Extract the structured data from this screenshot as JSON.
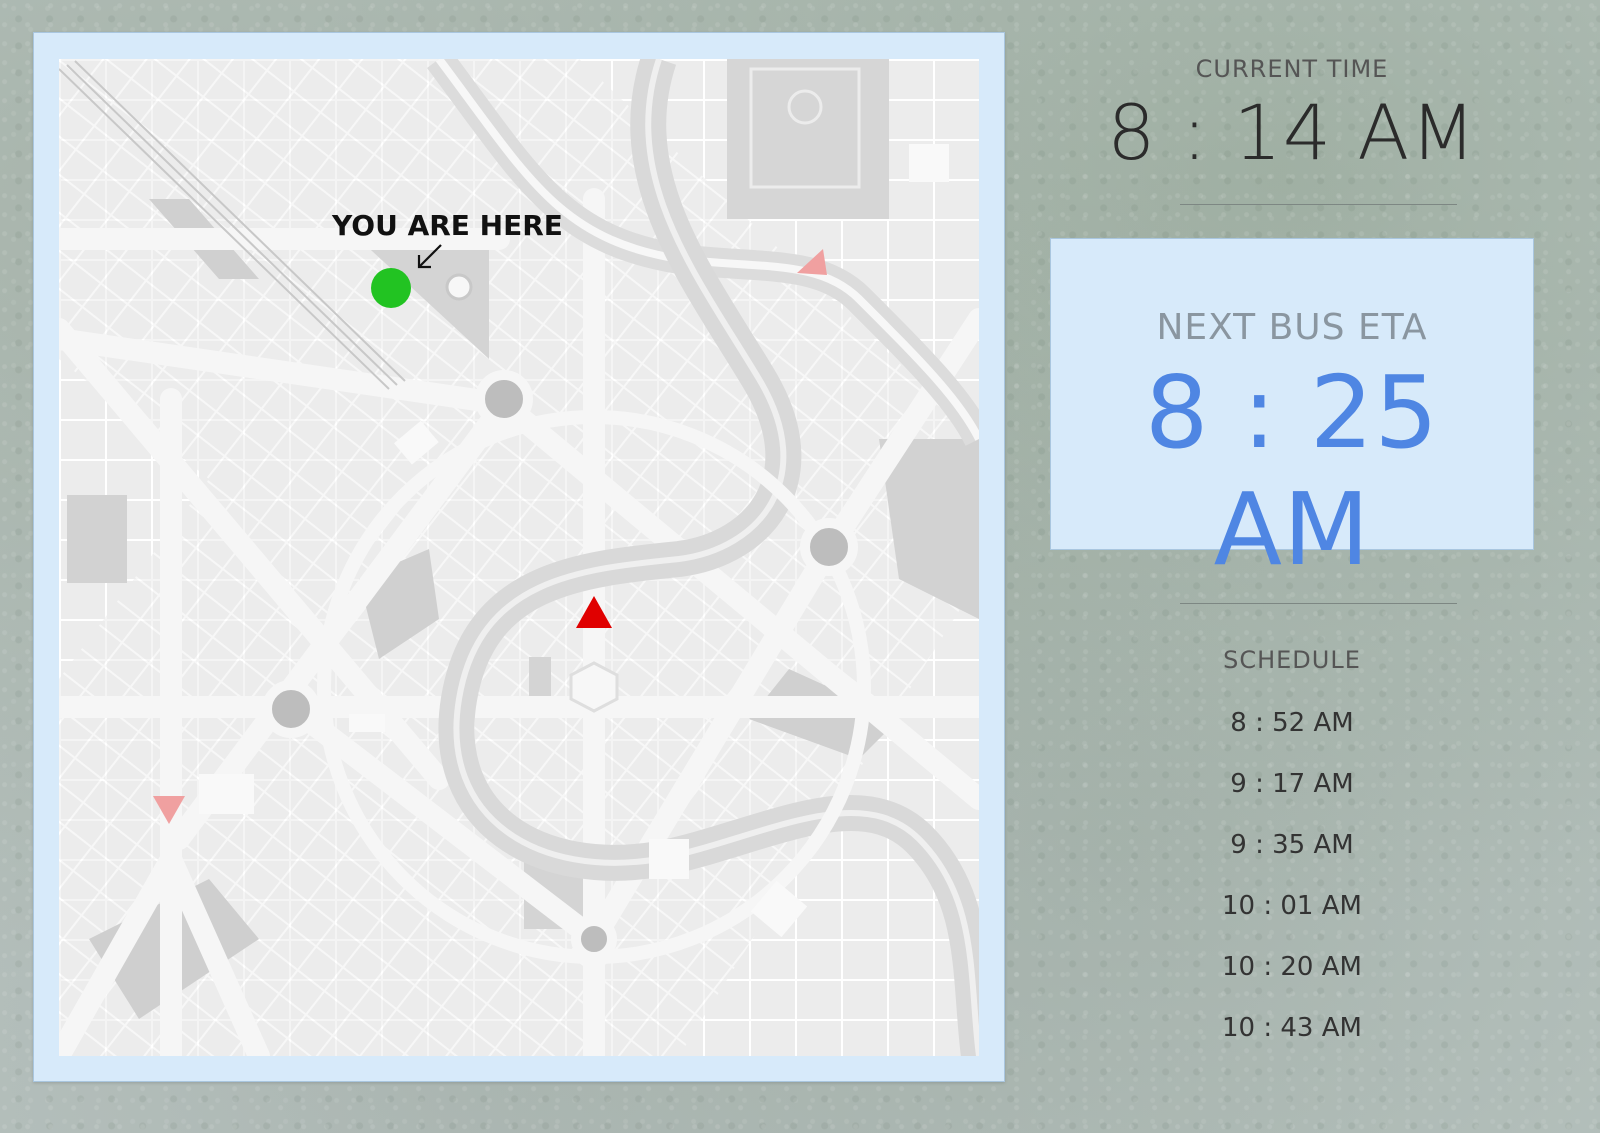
{
  "map": {
    "you_are_here_label": "YOU ARE HERE",
    "marker_color": "#22c322",
    "bus_marker_color": "#e00000",
    "bus_marker_faded_color": "#f0a0a0"
  },
  "current_time": {
    "label": "CURRENT TIME",
    "value": "8 : 14 AM"
  },
  "next_bus": {
    "label": "NEXT BUS ETA",
    "value": "8 : 25 AM",
    "accent_color": "#4f86e3"
  },
  "schedule": {
    "label": "SCHEDULE",
    "times": [
      "8 : 52 AM",
      "9 : 17 AM",
      "9 : 35 AM",
      "10 : 01 AM",
      "10 : 20 AM",
      "10 : 43 AM"
    ]
  }
}
